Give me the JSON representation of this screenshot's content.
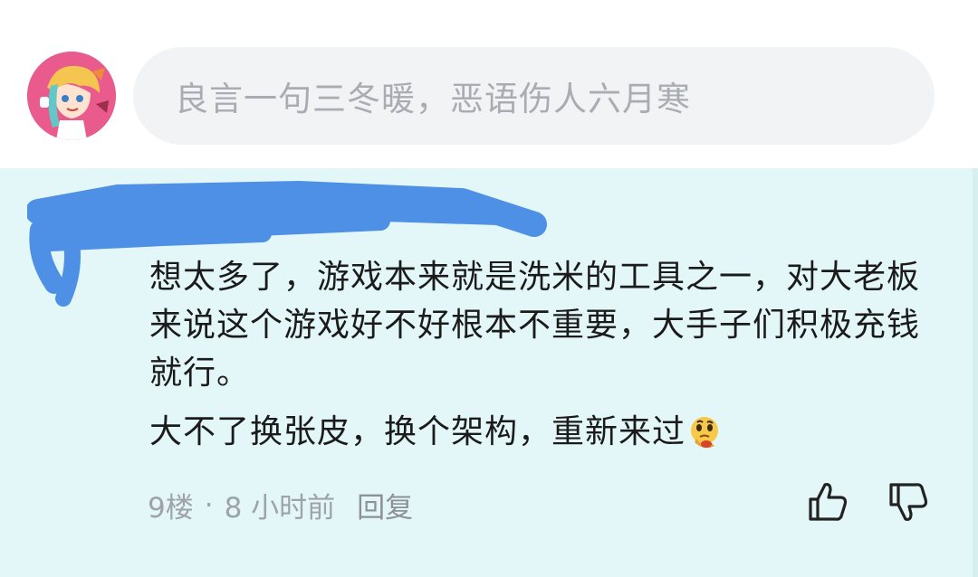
{
  "input": {
    "placeholder": "良言一句三冬暖，恶语伤人六月寒"
  },
  "comment": {
    "paragraph1": "想太多了，游戏本来就是洗米的工具之一，对大老板来说这个游戏好不好根本不重要，大手子们积极充钱就行。",
    "paragraph2": "大不了换张皮，换个架构，重新来过",
    "emoji": "thinking-face-emoji",
    "floor": "9楼",
    "separator": "·",
    "time": "8 小时前",
    "reply_label": "回复"
  },
  "colors": {
    "card_bg": "#e4f7f8",
    "input_bg": "#f2f3f5",
    "redaction": "#4e90e6",
    "text": "#1b1b1b",
    "meta": "#9ea3a9"
  },
  "icons": {
    "like": "thumbs-up-icon",
    "dislike": "thumbs-down-icon"
  }
}
